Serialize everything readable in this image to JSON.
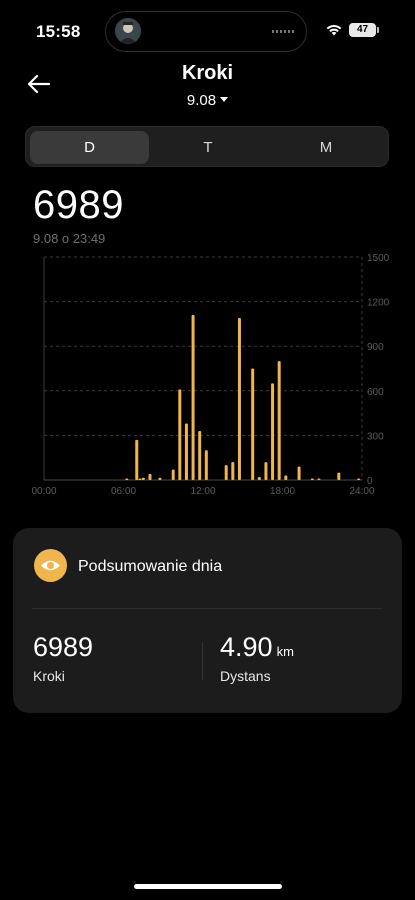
{
  "status_bar": {
    "time": "15:58",
    "battery": "47"
  },
  "header": {
    "title": "Kroki",
    "date": "9.08"
  },
  "tabs": [
    {
      "label": "D",
      "active": true
    },
    {
      "label": "T",
      "active": false
    },
    {
      "label": "M",
      "active": false
    }
  ],
  "summary_value": "6989",
  "summary_timestamp": "9.08 o 23:49",
  "chart_data": {
    "type": "bar",
    "x_tick_labels": [
      "00:00",
      "06:00",
      "12:00",
      "18:00",
      "24:00"
    ],
    "y_tick_labels": [
      "0",
      "300",
      "600",
      "900",
      "1200",
      "1500"
    ],
    "ylim": [
      0,
      1500
    ],
    "x_range_hours": [
      0,
      24
    ],
    "grid": true,
    "y_axis_position": "right",
    "bar_color": "#f0b54c",
    "bars": [
      {
        "hour": 6.25,
        "value": 5
      },
      {
        "hour": 7.0,
        "value": 270
      },
      {
        "hour": 7.25,
        "value": 5
      },
      {
        "hour": 7.5,
        "value": 15
      },
      {
        "hour": 8.0,
        "value": 40
      },
      {
        "hour": 8.75,
        "value": 15
      },
      {
        "hour": 9.75,
        "value": 70
      },
      {
        "hour": 10.25,
        "value": 610
      },
      {
        "hour": 10.75,
        "value": 380
      },
      {
        "hour": 11.25,
        "value": 1110
      },
      {
        "hour": 11.75,
        "value": 330
      },
      {
        "hour": 12.25,
        "value": 200
      },
      {
        "hour": 13.75,
        "value": 100
      },
      {
        "hour": 14.25,
        "value": 120
      },
      {
        "hour": 14.75,
        "value": 1090
      },
      {
        "hour": 15.75,
        "value": 750
      },
      {
        "hour": 16.25,
        "value": 20
      },
      {
        "hour": 16.75,
        "value": 120
      },
      {
        "hour": 17.25,
        "value": 650
      },
      {
        "hour": 17.75,
        "value": 800
      },
      {
        "hour": 18.25,
        "value": 30
      },
      {
        "hour": 19.25,
        "value": 90
      },
      {
        "hour": 20.25,
        "value": 5
      },
      {
        "hour": 20.75,
        "value": 8
      },
      {
        "hour": 22.25,
        "value": 50
      },
      {
        "hour": 23.75,
        "value": 5
      }
    ]
  },
  "card": {
    "title": "Podsumowanie dnia",
    "icon": "eye-icon",
    "steps_value": "6989",
    "steps_label": "Kroki",
    "distance_value": "4.90",
    "distance_unit": "km",
    "distance_label": "Dystans"
  },
  "colors": {
    "accent": "#f0b54c",
    "background": "#000000",
    "card": "#1c1c1c"
  }
}
